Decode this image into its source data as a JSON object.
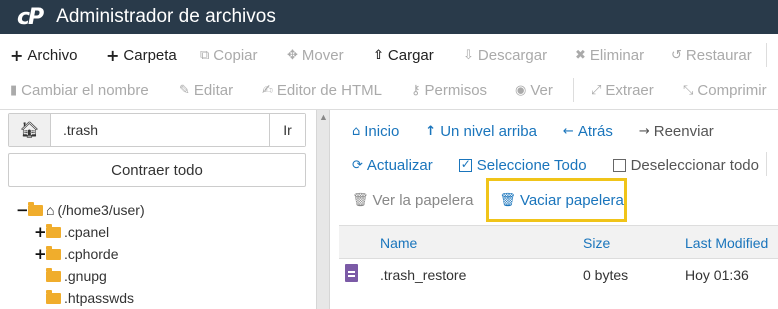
{
  "app": {
    "logo": "cP",
    "title": "Administrador de archivos"
  },
  "toolbar": {
    "row1": [
      {
        "label": "Archivo",
        "icon": "+"
      },
      {
        "label": "Carpeta",
        "icon": "+"
      },
      {
        "label": "Copiar",
        "icon": "⧉"
      },
      {
        "label": "Mover",
        "icon": "✥"
      },
      {
        "label": "Cargar",
        "icon": "⇧"
      },
      {
        "label": "Descargar",
        "icon": "⇩"
      },
      {
        "label": "Eliminar",
        "icon": "✖"
      },
      {
        "label": "Restaurar",
        "icon": "↺"
      }
    ],
    "row2": [
      {
        "label": "Cambiar el nombre",
        "icon": "▮"
      },
      {
        "label": "Editar",
        "icon": "✎"
      },
      {
        "label": "Editor de HTML",
        "icon": "✍"
      },
      {
        "label": "Permisos",
        "icon": "⚷"
      },
      {
        "label": "Ver",
        "icon": "◉"
      },
      {
        "label": "Extraer",
        "icon": "⤢"
      },
      {
        "label": "Comprimir",
        "icon": "⤡"
      }
    ]
  },
  "sidebar": {
    "path_value": ".trash",
    "go_label": "Ir",
    "collapse_label": "Contraer todo",
    "tree": {
      "root": "(/home3/user)",
      "items": [
        ".cpanel",
        ".cphorde",
        ".gnupg",
        ".htpasswds"
      ]
    }
  },
  "actions": {
    "inicio": "Inicio",
    "up": "Un nivel arriba",
    "back": "Atrás",
    "forward": "Reenviar",
    "refresh": "Actualizar",
    "select_all": "Seleccione Todo",
    "deselect_all": "Deseleccionar todo",
    "view_trash": "Ver la papelera",
    "empty_trash": "Vaciar papelera"
  },
  "table": {
    "columns": [
      "Name",
      "Size",
      "Last Modified"
    ],
    "rows": [
      {
        "name": ".trash_restore",
        "size": "0 bytes",
        "modified": "Hoy 01:36"
      }
    ]
  },
  "colors": {
    "titlebar": "#293a4a",
    "link": "#1a75bc",
    "folder": "#f0ad2c",
    "highlight": "#f0c419"
  }
}
